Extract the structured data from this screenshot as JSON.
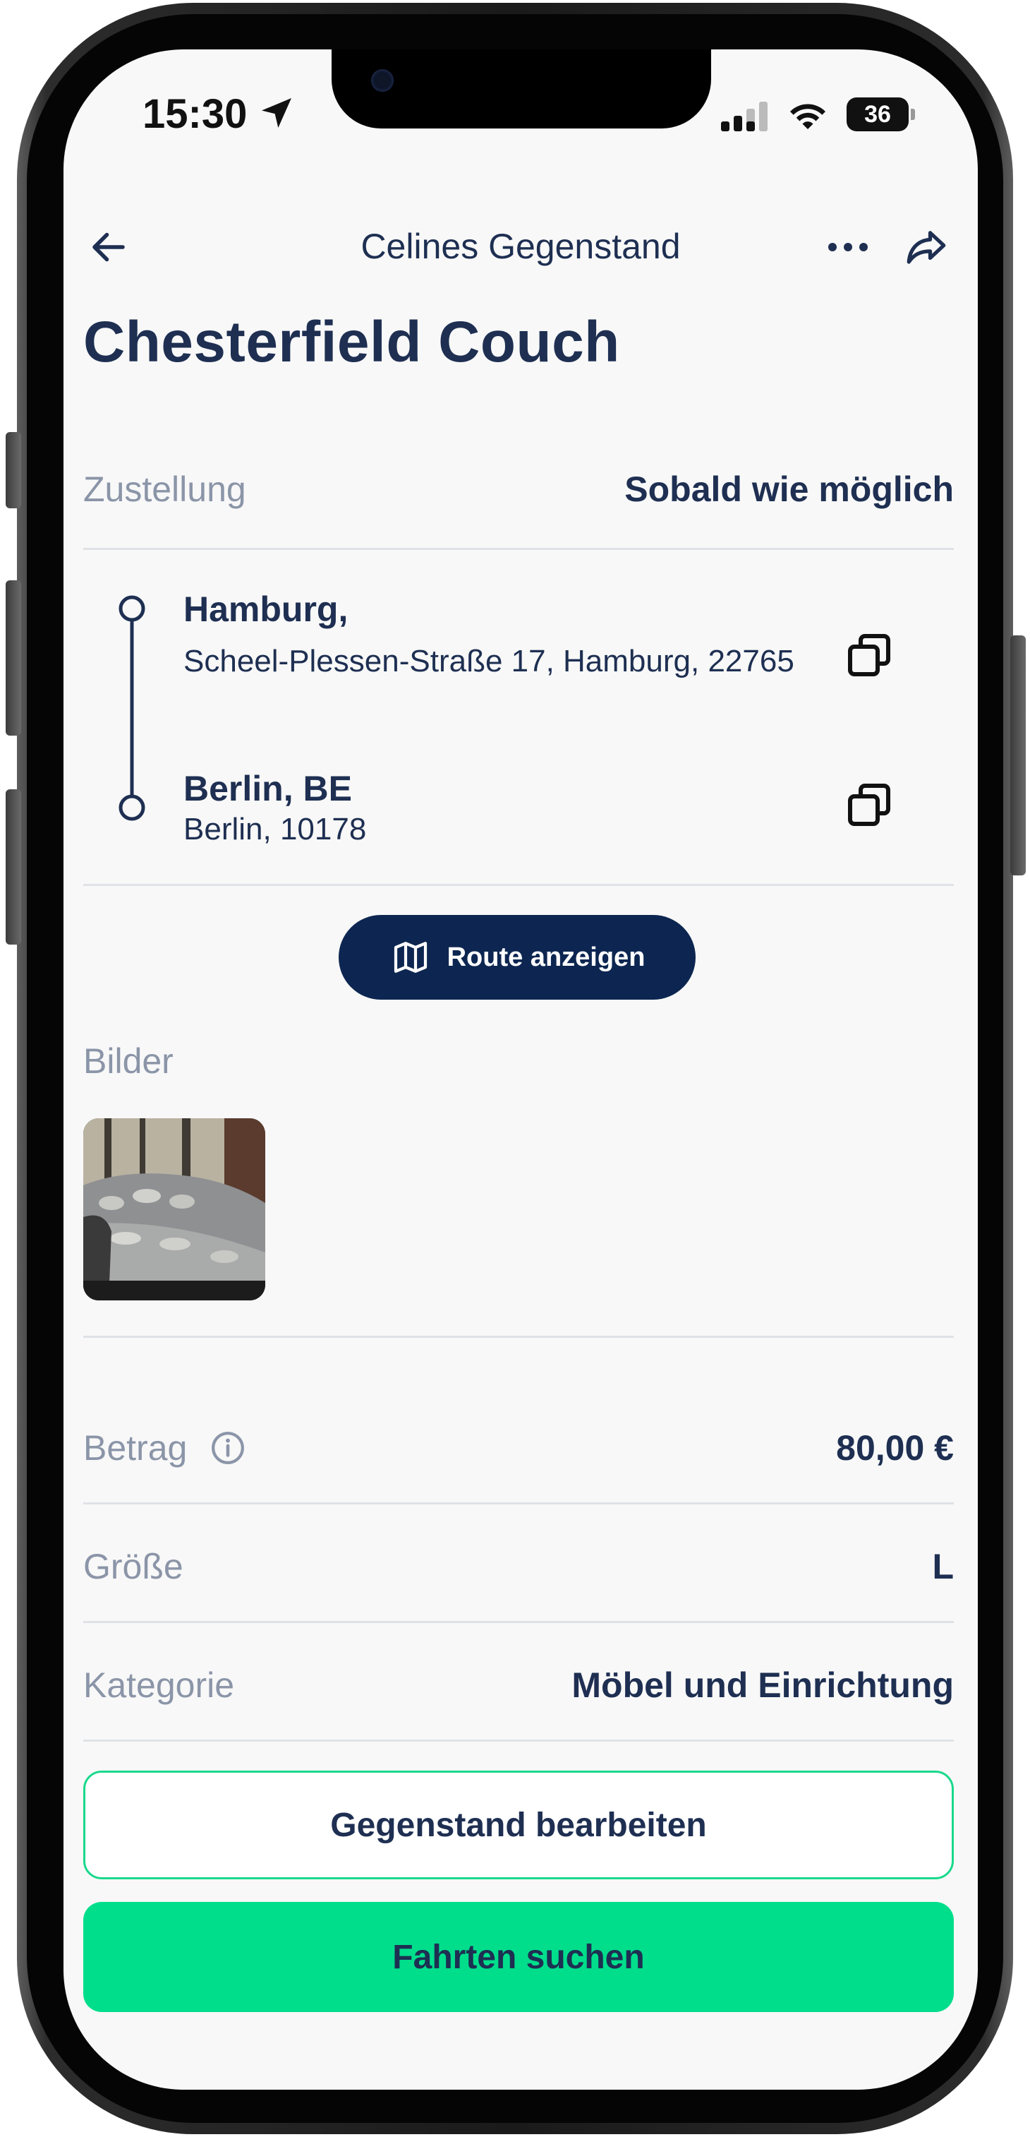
{
  "status_bar": {
    "time": "15:30",
    "battery": "36"
  },
  "nav": {
    "title": "Celines Gegenstand"
  },
  "item": {
    "title": "Chesterfield Couch"
  },
  "delivery": {
    "label": "Zustellung",
    "value": "Sobald wie möglich"
  },
  "route": {
    "origin": {
      "city": "Hamburg,",
      "address": "Scheel-Plessen-Straße 17,  Hamburg, 22765"
    },
    "destination": {
      "city": "Berlin, BE",
      "address": "Berlin, 10178"
    },
    "button_label": "Route anzeigen"
  },
  "images": {
    "label": "Bilder"
  },
  "details": {
    "amount": {
      "label": "Betrag",
      "value": "80,00 €"
    },
    "size": {
      "label": "Größe",
      "value": "L"
    },
    "category": {
      "label": "Kategorie",
      "value": "Möbel und Einrichtung"
    }
  },
  "actions": {
    "edit_label": "Gegenstand bearbeiten",
    "search_label": "Fahrten suchen"
  },
  "colors": {
    "primary": "#1e2f52",
    "navy_button": "#0d2651",
    "accent_green": "#00de8c",
    "muted": "#8b95a8"
  }
}
